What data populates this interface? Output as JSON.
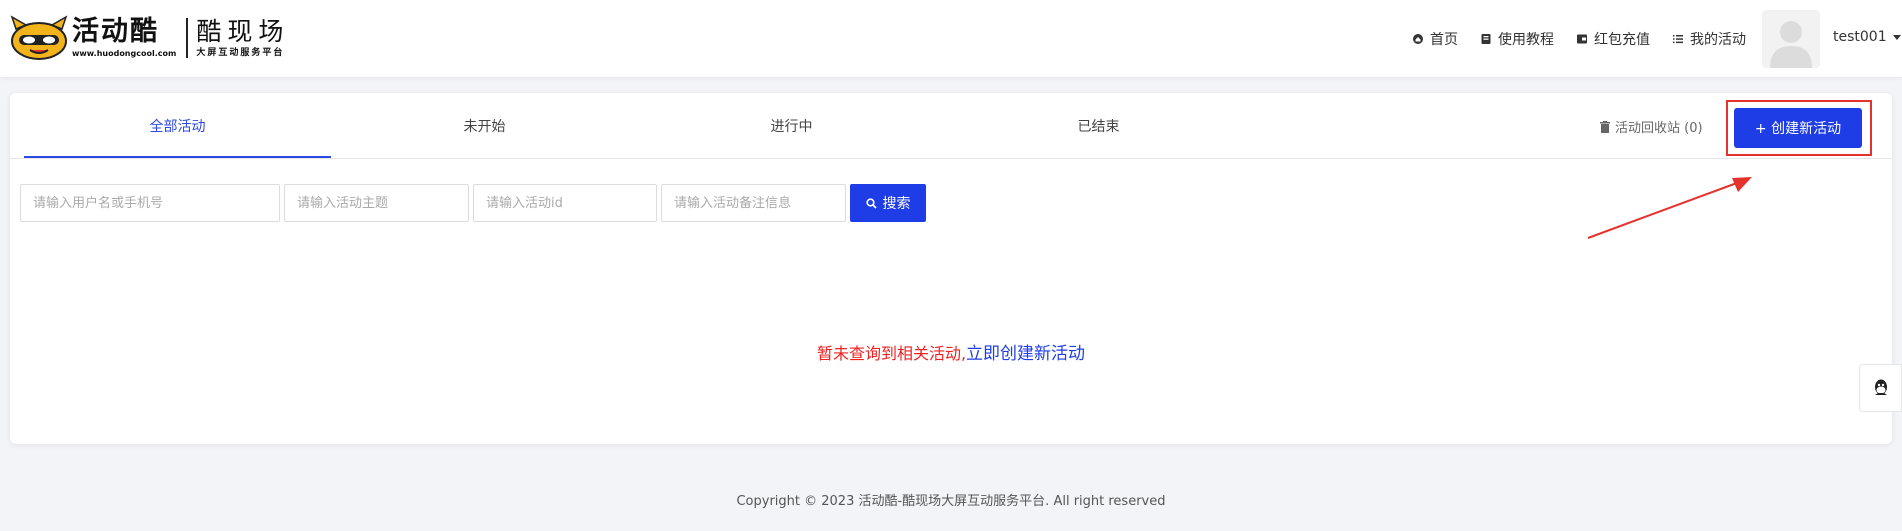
{
  "brand": {
    "name_cn": "活动酷",
    "url_text": "www.huodongcool.com",
    "sub_name": "酷现场",
    "slogan": "大屏互动服务平台"
  },
  "nav": {
    "items": [
      {
        "label": "首页",
        "icon": "home-icon"
      },
      {
        "label": "使用教程",
        "icon": "book-icon"
      },
      {
        "label": "红包充值",
        "icon": "wallet-icon"
      },
      {
        "label": "我的活动",
        "icon": "list-icon"
      }
    ]
  },
  "user": {
    "name": "test001"
  },
  "tabs": [
    {
      "label": "全部活动",
      "active": true
    },
    {
      "label": "未开始",
      "active": false
    },
    {
      "label": "进行中",
      "active": false
    },
    {
      "label": "已结束",
      "active": false
    }
  ],
  "trash": {
    "label": "活动回收站 (0)"
  },
  "create_button": {
    "label": "+ 创建新活动"
  },
  "filters": {
    "username_placeholder": "请输入用户名或手机号",
    "theme_placeholder": "请输入活动主题",
    "id_placeholder": "请输入活动id",
    "note_placeholder": "请输入活动备注信息",
    "search_label": "搜索"
  },
  "empty": {
    "message": "暂未查询到相关活动,",
    "link": "立即创建新活动"
  },
  "footer": {
    "text": "Copyright © 2023 活动酷-酷现场大屏互动服务平台. All right reserved"
  },
  "colors": {
    "accent": "#1f3de6",
    "highlight": "#e5322d",
    "empty_text": "#ee2222"
  }
}
